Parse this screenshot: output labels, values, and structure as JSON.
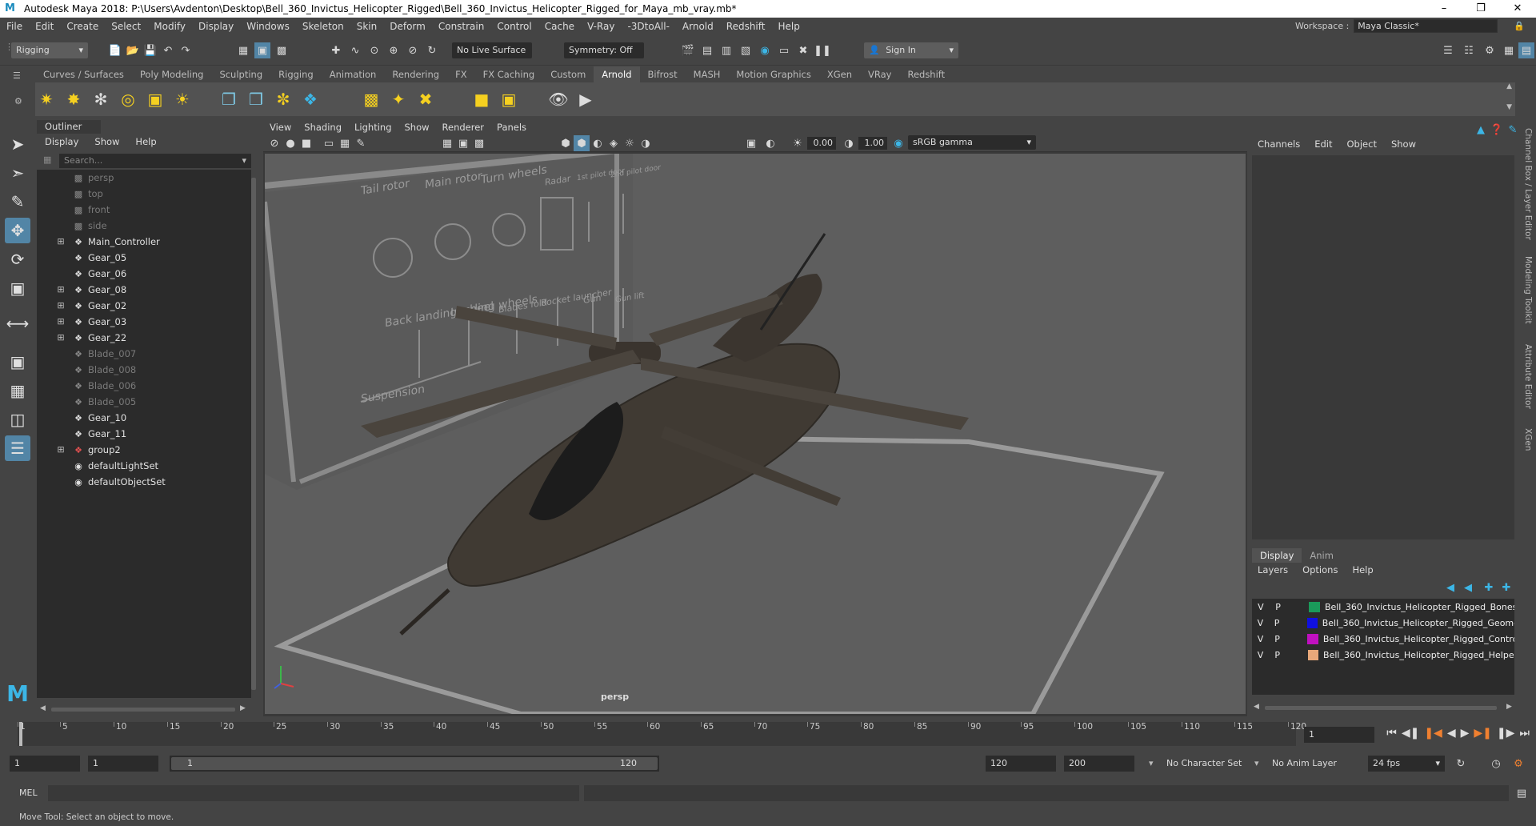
{
  "window": {
    "title": "Autodesk Maya 2018: P:\\Users\\Avdenton\\Desktop\\Bell_360_Invictus_Helicopter_Rigged\\Bell_360_Invictus_Helicopter_Rigged_for_Maya_mb_vray.mb*",
    "logo": "M"
  },
  "menubar": {
    "items": [
      "File",
      "Edit",
      "Create",
      "Select",
      "Modify",
      "Display",
      "Windows",
      "Skeleton",
      "Skin",
      "Deform",
      "Constrain",
      "Control",
      "Cache",
      "V-Ray",
      "-3DtoAll-",
      "Arnold",
      "Redshift",
      "Help"
    ],
    "workspace_label": "Workspace :",
    "workspace_value": "Maya Classic*"
  },
  "statusline": {
    "menuset": "Rigging",
    "live_surface": "No Live Surface",
    "symmetry": "Symmetry: Off",
    "sign_in": "Sign In"
  },
  "shelf": {
    "tabs": [
      "Curves / Surfaces",
      "Poly Modeling",
      "Sculpting",
      "Rigging",
      "Animation",
      "Rendering",
      "FX",
      "FX Caching",
      "Custom",
      "Arnold",
      "Bifrost",
      "MASH",
      "Motion Graphics",
      "XGen",
      "VRay",
      "Redshift"
    ],
    "active_tab": "Arnold",
    "icons": [
      "area-light-icon",
      "mesh-light-icon",
      "photometric-light-icon",
      "skydome-light-icon",
      "light-portal-icon",
      "physical-sky-icon",
      "standin-icon",
      "volume-icon",
      "curve-collector-icon",
      "render-view-icon",
      "material-ops-icon",
      "tx-manager-icon",
      "flush-cache-icon",
      "shader-icon",
      "render-icon",
      "ipr-icon"
    ]
  },
  "outliner": {
    "title": "Outliner",
    "menu": [
      "Display",
      "Show",
      "Help"
    ],
    "search_placeholder": "Search...",
    "items": [
      {
        "label": "persp",
        "type": "camera",
        "expandable": false,
        "dim": true
      },
      {
        "label": "top",
        "type": "camera",
        "expandable": false,
        "dim": true
      },
      {
        "label": "front",
        "type": "camera",
        "expandable": false,
        "dim": true
      },
      {
        "label": "side",
        "type": "camera",
        "expandable": false,
        "dim": true
      },
      {
        "label": "Main_Controller",
        "type": "transform",
        "expandable": true,
        "dim": false
      },
      {
        "label": "Gear_05",
        "type": "transform",
        "expandable": false,
        "dim": false
      },
      {
        "label": "Gear_06",
        "type": "transform",
        "expandable": false,
        "dim": false
      },
      {
        "label": "Gear_08",
        "type": "transform",
        "expandable": true,
        "dim": false
      },
      {
        "label": "Gear_02",
        "type": "transform",
        "expandable": true,
        "dim": false
      },
      {
        "label": "Gear_03",
        "type": "transform",
        "expandable": true,
        "dim": false
      },
      {
        "label": "Gear_22",
        "type": "transform",
        "expandable": true,
        "dim": false
      },
      {
        "label": "Blade_007",
        "type": "transform",
        "expandable": false,
        "dim": true
      },
      {
        "label": "Blade_008",
        "type": "transform",
        "expandable": false,
        "dim": true
      },
      {
        "label": "Blade_006",
        "type": "transform",
        "expandable": false,
        "dim": true
      },
      {
        "label": "Blade_005",
        "type": "transform",
        "expandable": false,
        "dim": true
      },
      {
        "label": "Gear_10",
        "type": "transform",
        "expandable": false,
        "dim": false
      },
      {
        "label": "Gear_11",
        "type": "transform",
        "expandable": false,
        "dim": false
      },
      {
        "label": "group2",
        "type": "group",
        "expandable": true,
        "dim": false
      },
      {
        "label": "defaultLightSet",
        "type": "set",
        "expandable": false,
        "dim": false
      },
      {
        "label": "defaultObjectSet",
        "type": "set",
        "expandable": false,
        "dim": false
      }
    ]
  },
  "viewport": {
    "menu": [
      "View",
      "Shading",
      "Lighting",
      "Show",
      "Renderer",
      "Panels"
    ],
    "exposure": "0.00",
    "gamma": "1.00",
    "color_space": "sRGB gamma",
    "camera_label": "persp",
    "board_labels": {
      "tail_rotor": "Tail rotor",
      "main_rotor": "Main rotor",
      "turn_wheels": "Turn wheels",
      "radar": "Radar",
      "first_pilot_door": "1st pilot door",
      "second_pilot_door": "2nd pilot door",
      "back_landing": "Back landing wheel",
      "landing_wheels": "Landing wheels",
      "blades_fold": "Blades fold",
      "rocket_launcher": "Rocket launcher",
      "gun": "Gun",
      "gun_lift": "Gun lift",
      "suspension": "Suspension"
    }
  },
  "channelbox": {
    "menu": [
      "Channels",
      "Edit",
      "Object",
      "Show"
    ],
    "layer_tabs": [
      "Display",
      "Anim"
    ],
    "active_layer_tab": "Display",
    "layer_menu": [
      "Layers",
      "Options",
      "Help"
    ],
    "layers": [
      {
        "v": "V",
        "p": "P",
        "color": "#1a9a5a",
        "name": "Bell_360_Invictus_Helicopter_Rigged_Bones"
      },
      {
        "v": "V",
        "p": "P",
        "color": "#1010e0",
        "name": "Bell_360_Invictus_Helicopter_Rigged_Geometr"
      },
      {
        "v": "V",
        "p": "P",
        "color": "#c010c0",
        "name": "Bell_360_Invictus_Helicopter_Rigged_Controll"
      },
      {
        "v": "V",
        "p": "P",
        "color": "#e8a87a",
        "name": "Bell_360_Invictus_Helicopter_Rigged_Helpers"
      }
    ],
    "side_tabs": [
      "Channel Box / Layer Editor",
      "Modeling Toolkit",
      "Attribute Editor",
      "XGen"
    ]
  },
  "timeline": {
    "ticks": [
      "1",
      "5",
      "10",
      "15",
      "20",
      "25",
      "30",
      "35",
      "40",
      "45",
      "50",
      "55",
      "60",
      "65",
      "70",
      "75",
      "80",
      "85",
      "90",
      "95",
      "100",
      "105",
      "110",
      "115",
      "120"
    ],
    "current_frame": "1"
  },
  "range": {
    "start": "1",
    "playback_start": "1",
    "slider_start": "1",
    "slider_end": "120",
    "playback_end": "120",
    "end": "200",
    "character_set": "No Character Set",
    "anim_layer": "No Anim Layer",
    "fps": "24 fps"
  },
  "cmdline": {
    "label": "MEL"
  },
  "helpline": {
    "text": "Move Tool: Select an object to move."
  },
  "colors": {
    "accent": "#5285a6",
    "panel": "#444444",
    "field": "#2b2b2b"
  }
}
